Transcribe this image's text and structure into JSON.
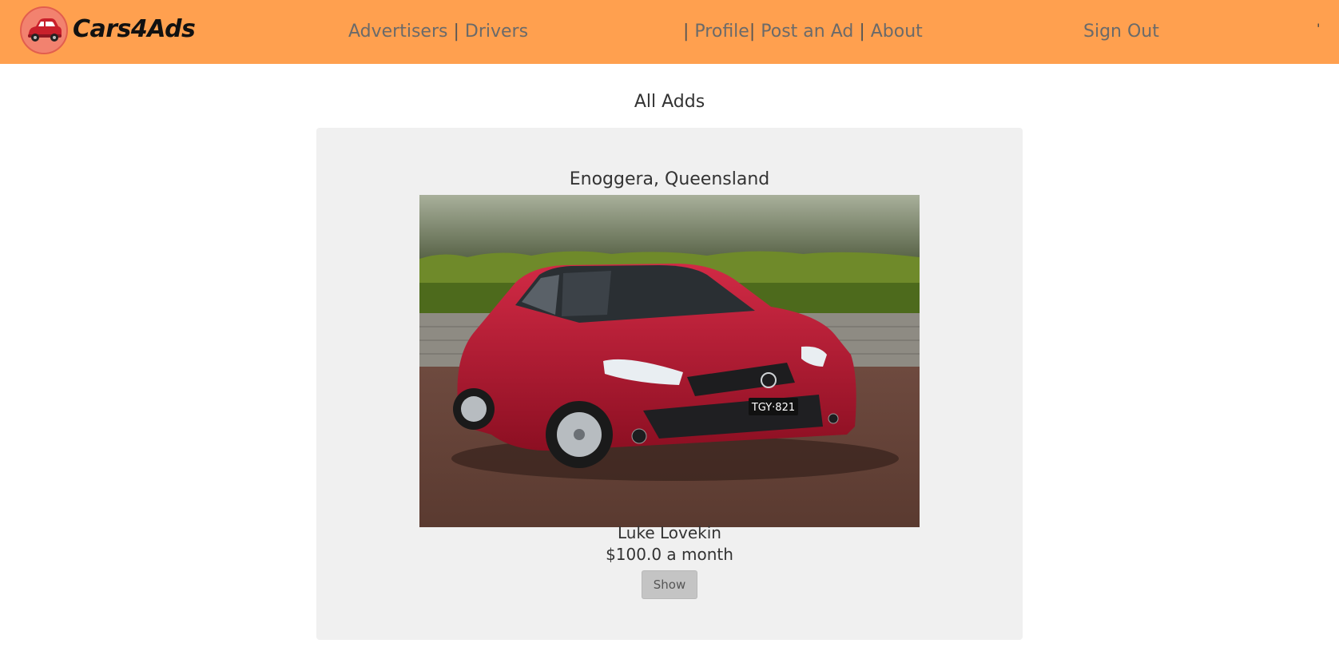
{
  "navbar": {
    "brand": "Cars4Ads",
    "logo_icon": "car-logo-icon",
    "links_left": {
      "advertisers": "Advertisers",
      "separator": "|",
      "drivers": "Drivers"
    },
    "links_center": {
      "separator_1": "|",
      "profile": "Profile",
      "separator_2": "|",
      "post_ad": "Post an Ad",
      "separator_3": "|",
      "about": "About"
    },
    "sign_out": "Sign Out",
    "stray_mark": "'",
    "background_color": "#ffa04f"
  },
  "main": {
    "title": "All Adds",
    "ads": [
      {
        "location": "Enoggera, Queensland",
        "photo_icon": "red-sedan-photo",
        "plate": "TGY·821",
        "owner": "Luke Lovekin",
        "price": "$100.0 a month",
        "button_label": "Show"
      }
    ]
  },
  "colors": {
    "card_background": "#f0f0f0",
    "button_background": "#c4c4c4",
    "car_red": "#b5122e"
  }
}
